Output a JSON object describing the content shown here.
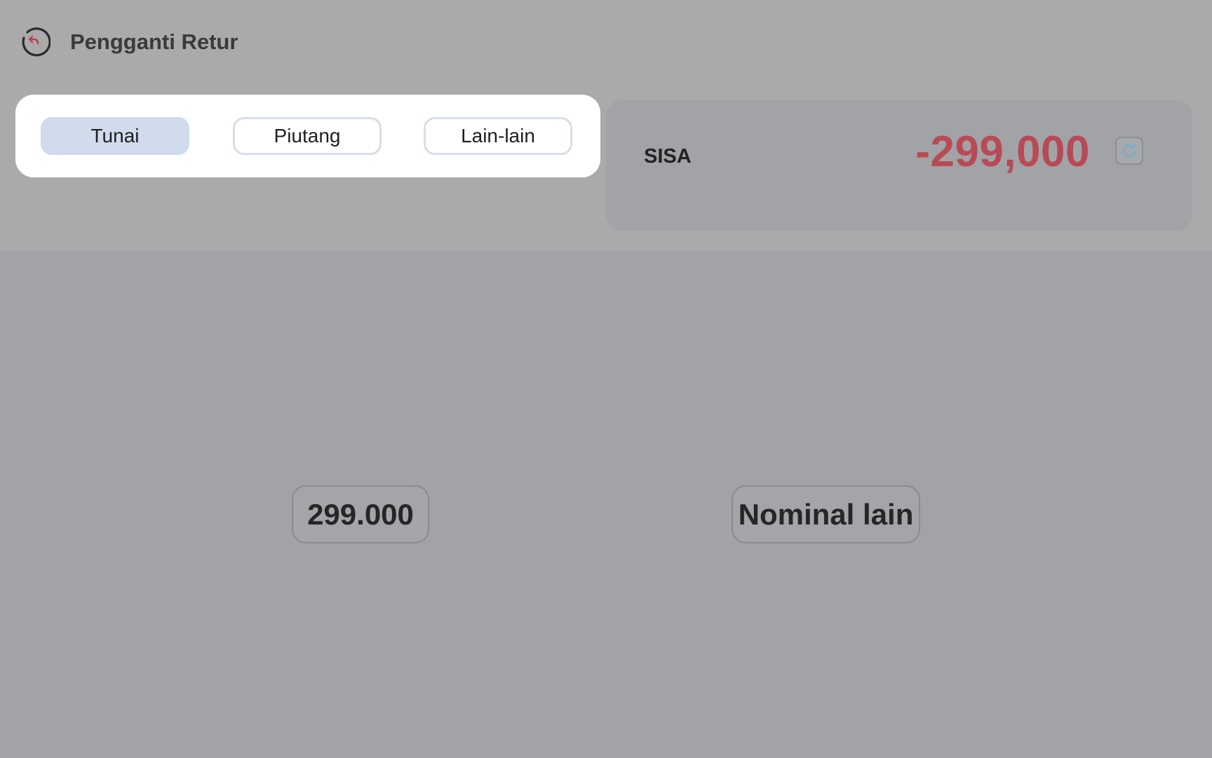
{
  "header": {
    "title": "Pengganti Retur",
    "back_icon": "back-arrow-circle-icon"
  },
  "tabs": [
    {
      "label": "Tunai",
      "active": true
    },
    {
      "label": "Piutang",
      "active": false
    },
    {
      "label": "Lain-lain",
      "active": false
    }
  ],
  "sisa": {
    "label": "SISA",
    "value": "-299,000",
    "refresh_icon": "refresh-icon"
  },
  "amounts": [
    {
      "label": "299.000"
    },
    {
      "label": "Nominal lain"
    }
  ],
  "colors": {
    "overlay_top": "#aaaaaa",
    "overlay_bottom": "#a2a3a6",
    "negative_value": "#b84a56",
    "active_tab": "#d0dcec",
    "accent_icon": "#c0404f",
    "refresh_accent": "#6fb0c8"
  }
}
